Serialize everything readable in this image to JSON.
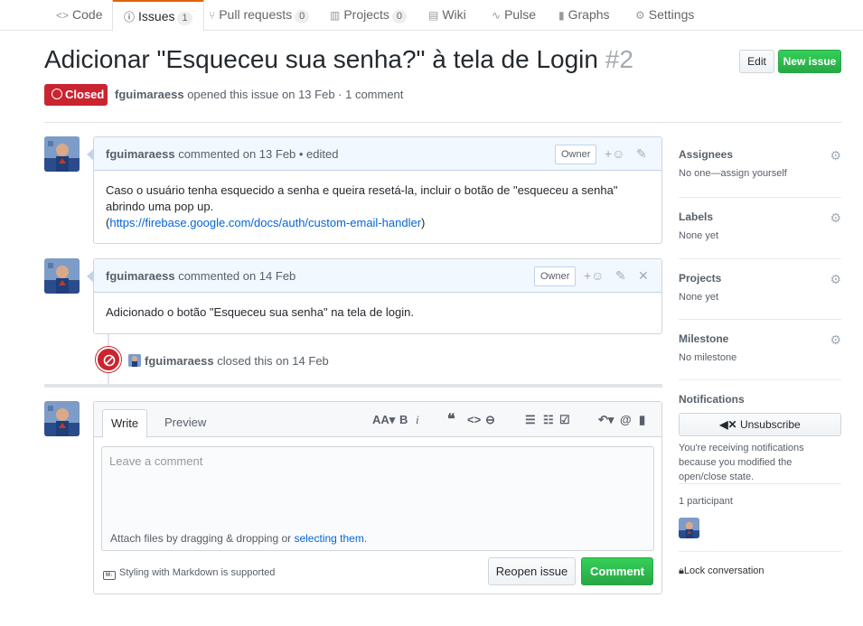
{
  "nav": {
    "code": "Code",
    "issues": "Issues",
    "issues_count": "1",
    "pulls": "Pull requests",
    "pulls_count": "0",
    "projects": "Projects",
    "projects_count": "0",
    "wiki": "Wiki",
    "pulse": "Pulse",
    "graphs": "Graphs",
    "settings": "Settings"
  },
  "issue": {
    "title": "Adicionar \"Esqueceu sua senha?\" à tela de Login",
    "number": "#2",
    "state": "Closed",
    "author": "fguimaraess",
    "meta_text": " opened this issue on 13 Feb · 1 comment",
    "edit_label": "Edit",
    "new_issue_label": "New issue"
  },
  "comments": [
    {
      "author": "fguimaraess",
      "meta": " commented on 13 Feb • edited",
      "badge": "Owner",
      "body_line1": "Caso o usuário tenha esquecido a senha e queira resetá-la, incluir o botão de \"esqueceu a senha\" abrindo uma pop up.",
      "body_link": "https://firebase.google.com/docs/auth/custom-email-handler",
      "body_open": "(",
      "body_close": ")"
    },
    {
      "author": "fguimaraess",
      "meta": " commented on 14 Feb",
      "badge": "Owner",
      "body_line1": "Adicionado o botão \"Esqueceu sua senha\" na tela de login."
    }
  ],
  "event": {
    "author": "fguimaraess",
    "text": " closed this on 14 Feb"
  },
  "form": {
    "tab_write": "Write",
    "tab_preview": "Preview",
    "placeholder": "Leave a comment",
    "attach_text": "Attach files by dragging & dropping or ",
    "attach_link": "selecting them",
    "attach_end": ".",
    "markdown_note": "Styling with Markdown is supported",
    "reopen_label": "Reopen issue",
    "comment_label": "Comment"
  },
  "sidebar": {
    "assignees_h": "Assignees",
    "assignees_v": "No one—assign yourself",
    "labels_h": "Labels",
    "labels_v": "None yet",
    "projects_h": "Projects",
    "projects_v": "None yet",
    "milestone_h": "Milestone",
    "milestone_v": "No milestone",
    "notifications_h": "Notifications",
    "unsubscribe_label": "Unsubscribe",
    "notif_text": "You're receiving notifications because you modified the open/close state.",
    "participants_h": "1 participant",
    "lock_label": "Lock conversation"
  },
  "colors": {
    "closed": "#cb2431",
    "primary": "#28a745",
    "link": "#0366d6",
    "accent_tab": "#e36209"
  }
}
